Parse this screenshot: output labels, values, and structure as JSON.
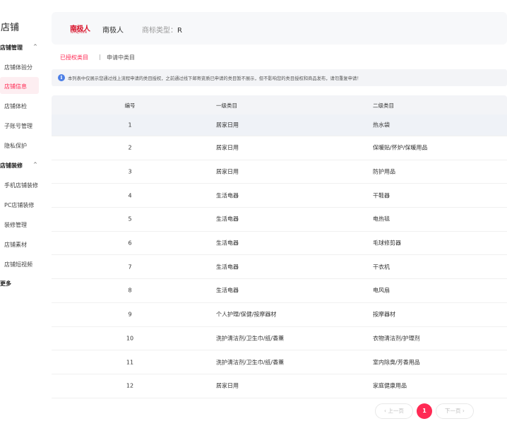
{
  "sidebar": {
    "title": "店铺",
    "groups": [
      {
        "label": "店铺管理",
        "caret": "^",
        "items": [
          "店铺体验分",
          "店铺信息",
          "店铺体检",
          "子账号管理",
          "隐私保护"
        ]
      },
      {
        "label": "店铺装修",
        "caret": "^",
        "items": [
          "手机店铺装修",
          "PC店铺装修",
          "装修管理",
          "店铺素材",
          "店铺短视频"
        ]
      }
    ],
    "active_item": "店铺信息",
    "more": "更多"
  },
  "brand": {
    "logo_cn": "南极人",
    "logo_en": "NANJIREN",
    "name": "南极人",
    "type_label": "商标类型：",
    "type_value": "R"
  },
  "tabs": {
    "active": "已授权类目",
    "separator": "|",
    "inactive": "申请中类目"
  },
  "notice": {
    "icon": "info-icon",
    "text": "本列表中仅展示您通过线上流程申请的类目授权，之前通过线下邮寄资质已申请的类目暂不展示，但不影响您的类目授权和商品发布，请勿重复申请！"
  },
  "table": {
    "headers": [
      "编号",
      "一级类目",
      "二级类目"
    ],
    "rows": [
      {
        "id": "1",
        "l1": "居家日用",
        "l2": "热水袋"
      },
      {
        "id": "2",
        "l1": "居家日用",
        "l2": "保暖贴/怀炉/保暖用品"
      },
      {
        "id": "3",
        "l1": "居家日用",
        "l2": "防护用品"
      },
      {
        "id": "4",
        "l1": "生活电器",
        "l2": "干鞋器"
      },
      {
        "id": "5",
        "l1": "生活电器",
        "l2": "电热毯"
      },
      {
        "id": "6",
        "l1": "生活电器",
        "l2": "毛球修剪器"
      },
      {
        "id": "7",
        "l1": "生活电器",
        "l2": "干衣机"
      },
      {
        "id": "8",
        "l1": "生活电器",
        "l2": "电风扇"
      },
      {
        "id": "9",
        "l1": "个人护理/保健/按摩器材",
        "l2": "按摩器材"
      },
      {
        "id": "10",
        "l1": "洗护清洁剂/卫生巾/纸/香薰",
        "l2": "衣物清洁剂/护理剂"
      },
      {
        "id": "11",
        "l1": "洗护清洁剂/卫生巾/纸/香薰",
        "l2": "室内除臭/芳香用品"
      },
      {
        "id": "12",
        "l1": "居家日用",
        "l2": "家庭健康用品"
      }
    ]
  },
  "pagination": {
    "prev": "‹ 上一页",
    "current": "1",
    "next": "下一页 ›"
  },
  "colors": {
    "accent": "#ff2a54",
    "brand_red": "#d8122a",
    "info_blue": "#4c7fe6",
    "panel_bg": "#f7f8fa",
    "header_bg": "#f3f4f7"
  }
}
